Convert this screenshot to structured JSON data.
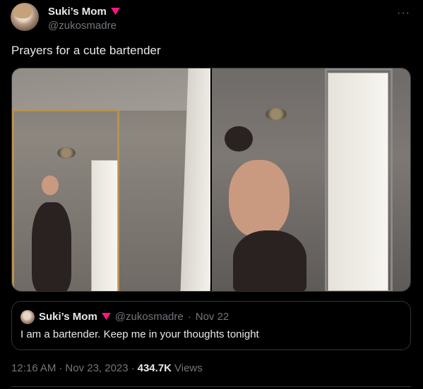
{
  "tweet": {
    "author": {
      "display_name": "Suki’s Mom",
      "handle": "@zukosmadre",
      "badge_icon": "red-heart-icon"
    },
    "more_icon": "···",
    "text": "Prayers for a cute bartender",
    "quoted": {
      "display_name": "Suki’s Mom",
      "handle": "@zukosmadre",
      "separator": "·",
      "date": "Nov 22",
      "text": "I am a bartender. Keep me in your thoughts tonight"
    },
    "meta": {
      "time": "12:16 AM",
      "sep1": "·",
      "date": "Nov 23, 2023",
      "sep2": "·",
      "views_count": "434.7K",
      "views_label": "Views"
    },
    "colors": {
      "background": "#000000",
      "text": "#e7e9ea",
      "muted": "#71767b",
      "border": "#2f3336",
      "heart": "#f91880"
    }
  }
}
